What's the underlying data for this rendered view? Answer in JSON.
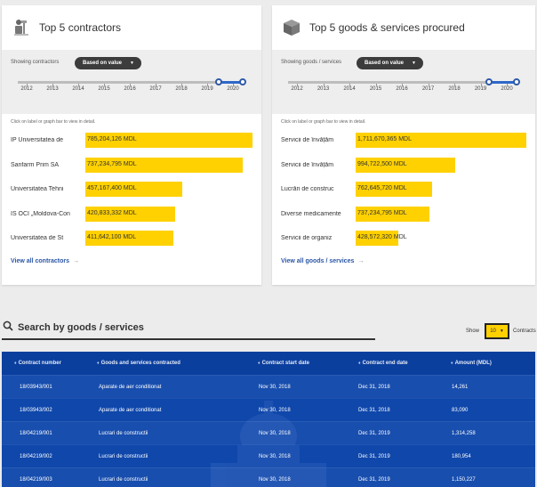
{
  "contractors": {
    "title": "Top 5 contractors",
    "filter_label": "Showing contractors",
    "sort_label": "Based on value",
    "years": [
      "2012",
      "2013",
      "2014",
      "2015",
      "2016",
      "2017",
      "2018",
      "2019",
      "2020"
    ],
    "hint": "Click on label or graph bar to view in detail.",
    "view_all": "View all contractors",
    "arrow": "→",
    "items": [
      {
        "label": "IP Universitatea de",
        "value": "785,204,126 MDL",
        "fraction": 1.0
      },
      {
        "label": "Sanfarm Prim SA",
        "value": "737,234,795 MDL",
        "fraction": 0.939
      },
      {
        "label": "Universitatea Tehni",
        "value": "457,167,400 MDL",
        "fraction": 0.582
      },
      {
        "label": "ÎS OCI „Moldova-Con",
        "value": "420,833,332 MDL",
        "fraction": 0.536
      },
      {
        "label": "Universitatea de St",
        "value": "411,642,100 MDL",
        "fraction": 0.524
      }
    ]
  },
  "goods": {
    "title": "Top 5 goods & services procured",
    "filter_label": "Showing goods / services",
    "sort_label": "Based on value",
    "years": [
      "2012",
      "2013",
      "2014",
      "2015",
      "2016",
      "2017",
      "2018",
      "2019",
      "2020"
    ],
    "hint": "Click on label or graph bar to view in detail.",
    "view_all": "View all goods / services",
    "arrow": "→",
    "items": [
      {
        "label": "Servicii de învățăm",
        "value": "1,711,670,365 MDL",
        "fraction": 1.0
      },
      {
        "label": "Servicii de învățăm",
        "value": "994,722,500 MDL",
        "fraction": 0.581
      },
      {
        "label": "Lucrări de construc",
        "value": "762,645,720 MDL",
        "fraction": 0.446
      },
      {
        "label": "Diverse medicamente",
        "value": "737,234,795 MDL",
        "fraction": 0.431
      },
      {
        "label": "Servicii de organiz",
        "value": "428,572,320 MDL",
        "fraction": 0.25
      }
    ]
  },
  "search": {
    "title": "Search by goods / services",
    "show_label": "Show",
    "show_value": "10",
    "contracts_label": "Contracts"
  },
  "table": {
    "headers": [
      "Contract number",
      "Goods and services contracted",
      "Contract start date",
      "Contract end date",
      "Amount (MDL)"
    ],
    "rows": [
      [
        "18/03943/001",
        "Aparate de aer conditionat",
        "Nov 30, 2018",
        "Dec 31, 2018",
        "14,261"
      ],
      [
        "18/03943/002",
        "Aparate de aer conditionat",
        "Nov 30, 2018",
        "Dec 31, 2018",
        "83,090"
      ],
      [
        "18/04219/001",
        "Lucrari de constructii",
        "Nov 30, 2018",
        "Dec 31, 2019",
        "1,314,258"
      ],
      [
        "18/04219/002",
        "Lucrari de constructii",
        "Nov 30, 2018",
        "Dec 31, 2019",
        "180,954"
      ],
      [
        "18/04219/003",
        "Lucrari de constructii",
        "Nov 30, 2018",
        "Dec 31, 2019",
        "1,150,227"
      ]
    ]
  },
  "colors": {
    "bar": "#ffd100",
    "accent": "#2f67c9",
    "table_bg": "#0f47ab",
    "link": "#2a56a6"
  }
}
